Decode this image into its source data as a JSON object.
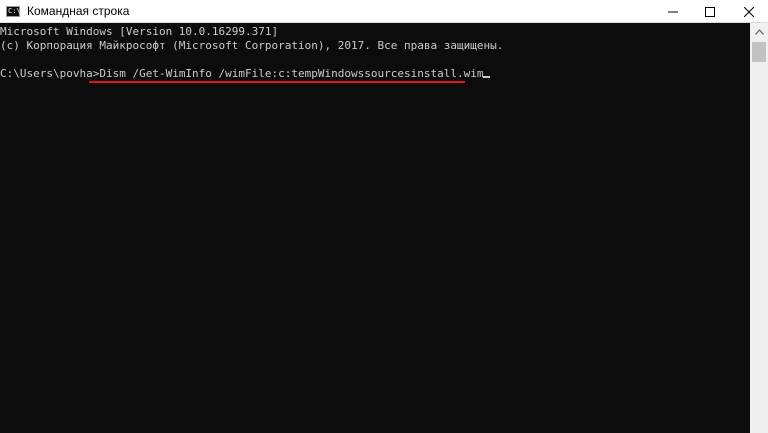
{
  "window": {
    "title": "Командная строка",
    "icon": "console-app-icon",
    "icon_glyph": "C:\\",
    "controls": [
      "minimize-icon",
      "maximize-icon",
      "close-icon"
    ]
  },
  "console": {
    "line1": "Microsoft Windows [Version 10.0.16299.371]",
    "line2": "(c) Корпорация Майкрософт (Microsoft Corporation), 2017. Все права защищены.",
    "prompt": "C:\\Users\\povha>",
    "command": "Dism /Get-WimInfo /wimFile:c:tempWindowssourcesinstall.wim",
    "highlight_color": "#e0161a",
    "text_color": "#cccccc",
    "background_color": "#0c0c0c"
  },
  "scrollbar": {
    "up_arrow": "chevron-up-icon"
  }
}
